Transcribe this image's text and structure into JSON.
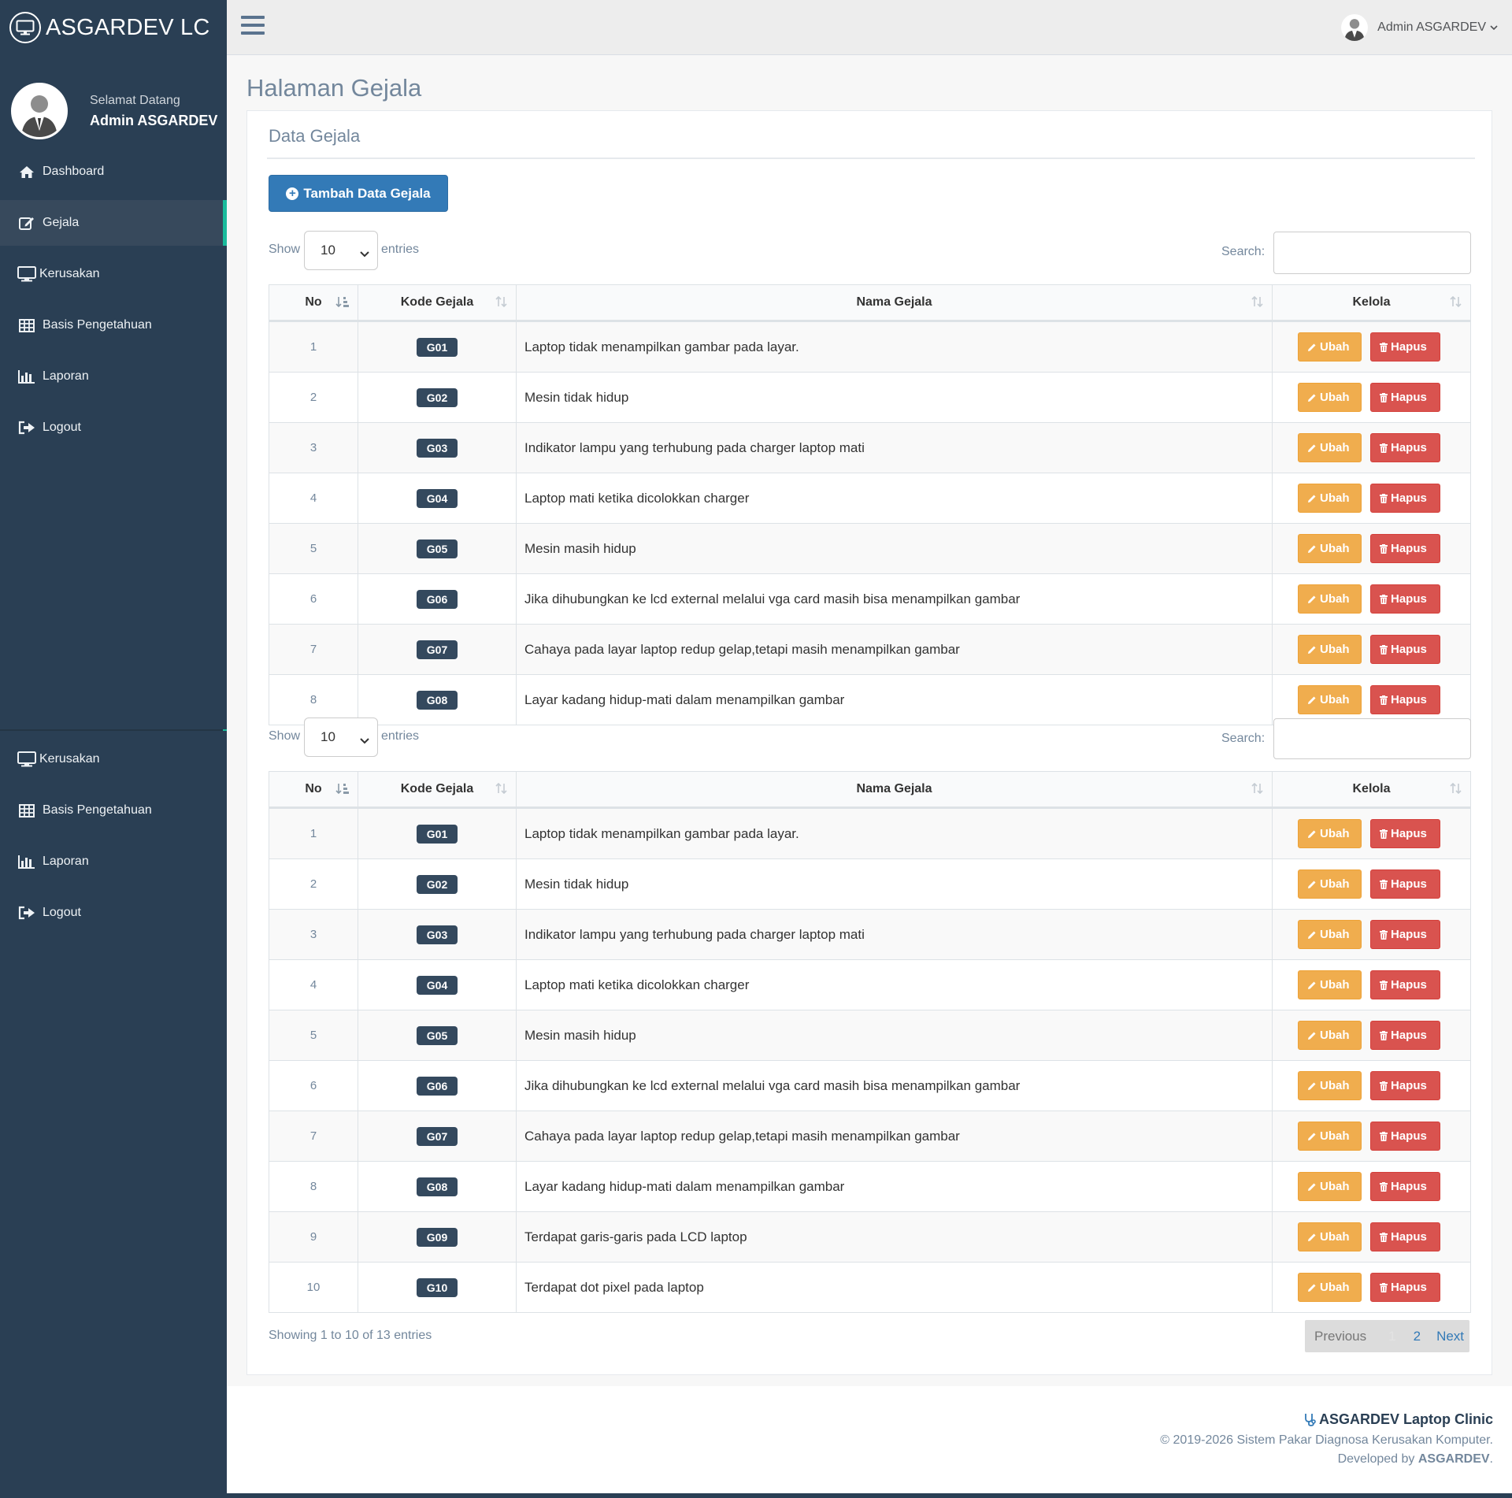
{
  "brand": {
    "title": "ASGARDEV LC"
  },
  "profile": {
    "welcome": "Selamat Datang",
    "name": "Admin ASGARDEV"
  },
  "sidebar": {
    "items": [
      {
        "label": "Dashboard",
        "icon": "home-icon"
      },
      {
        "label": "Gejala",
        "icon": "edit-icon",
        "active": true
      },
      {
        "label": "Kerusakan",
        "icon": "monitor-icon"
      },
      {
        "label": "Basis Pengetahuan",
        "icon": "table-icon"
      },
      {
        "label": "Laporan",
        "icon": "bar-chart-icon"
      },
      {
        "label": "Logout",
        "icon": "sign-out-icon"
      }
    ],
    "items_repeat": [
      {
        "label": "Kerusakan",
        "icon": "monitor-icon"
      },
      {
        "label": "Basis Pengetahuan",
        "icon": "table-icon"
      },
      {
        "label": "Laporan",
        "icon": "bar-chart-icon"
      },
      {
        "label": "Logout",
        "icon": "sign-out-icon"
      }
    ]
  },
  "topnav": {
    "user_name": "Admin ASGARDEV"
  },
  "page": {
    "title": "Halaman Gejala"
  },
  "panel": {
    "title": "Data Gejala",
    "add_button": "Tambah Data Gejala"
  },
  "controls": {
    "show_label": "Show",
    "entries_label": "entries",
    "page_size": "10",
    "search_label": "Search:",
    "search_value": ""
  },
  "table": {
    "headers": {
      "no": "No",
      "code": "Kode Gejala",
      "name": "Nama Gejala",
      "action": "Kelola"
    },
    "edit_label": "Ubah",
    "delete_label": "Hapus",
    "rows": [
      {
        "no": "1",
        "code": "G01",
        "name": "Laptop tidak menampilkan gambar pada layar."
      },
      {
        "no": "2",
        "code": "G02",
        "name": "Mesin tidak hidup"
      },
      {
        "no": "3",
        "code": "G03",
        "name": "Indikator lampu yang terhubung pada charger laptop mati"
      },
      {
        "no": "4",
        "code": "G04",
        "name": "Laptop mati ketika dicolokkan charger"
      },
      {
        "no": "5",
        "code": "G05",
        "name": "Mesin masih hidup"
      },
      {
        "no": "6",
        "code": "G06",
        "name": "Jika dihubungkan ke lcd external melalui vga card masih bisa menampilkan gambar"
      },
      {
        "no": "7",
        "code": "G07",
        "name": "Cahaya pada layar laptop redup gelap,tetapi masih menampilkan gambar"
      },
      {
        "no": "8",
        "code": "G08",
        "name": "Layar kadang hidup-mati dalam menampilkan gambar"
      },
      {
        "no": "9",
        "code": "G09",
        "name": "Terdapat garis-garis pada LCD laptop"
      },
      {
        "no": "10",
        "code": "G10",
        "name": "Terdapat dot pixel pada laptop"
      }
    ]
  },
  "pagination": {
    "info": "Showing 1 to 10 of 13 entries",
    "previous": "Previous",
    "page1": "1",
    "page2": "2",
    "next": "Next"
  },
  "footer": {
    "brand": "ASGARDEV Laptop Clinic",
    "copyright": "© 2019-2026 Sistem Pakar Diagnosa Kerusakan Komputer.",
    "dev_prefix": "Developed by",
    "dev_name": "ASGARDEV",
    "dev_suffix": "."
  },
  "colors": {
    "sidebar": "#2a3f54",
    "accent": "#1abb9c",
    "primary": "#337ab7",
    "warning": "#f0ad4e",
    "danger": "#d9534f",
    "badge": "#34495e"
  }
}
